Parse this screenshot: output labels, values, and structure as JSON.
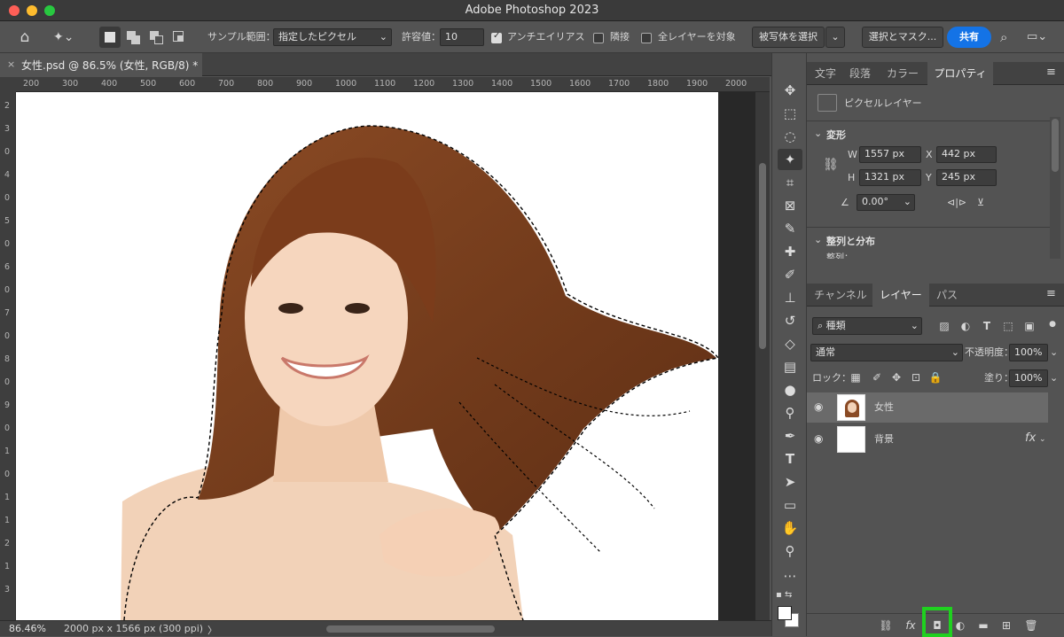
{
  "app": {
    "title": "Adobe Photoshop 2023"
  },
  "options_bar": {
    "sample_label": "サンプル範囲：",
    "sample_value": "指定したピクセル",
    "tolerance_label": "許容値：",
    "tolerance_value": "10",
    "antialias_label": "アンチエイリアス",
    "antialias_checked": true,
    "contiguous_label": "隣接",
    "contiguous_checked": false,
    "all_layers_label": "全レイヤーを対象",
    "all_layers_checked": false,
    "select_subject": "被写体を選択",
    "select_mask": "選択とマスク...",
    "share": "共有"
  },
  "document": {
    "tab_title": "女性.psd @ 86.5% (女性, RGB/8) *",
    "close_glyph": "×"
  },
  "ruler": {
    "h_ticks": [
      "200",
      "300",
      "400",
      "500",
      "600",
      "700",
      "800",
      "900",
      "1000",
      "1100",
      "1200",
      "1300",
      "1400",
      "1500",
      "1600",
      "1700",
      "1800",
      "1900",
      "2000"
    ],
    "v_ticks": [
      "2",
      "3",
      "0",
      "4",
      "0",
      "5",
      "0",
      "6",
      "0",
      "7",
      "0",
      "8",
      "0",
      "9",
      "0",
      "1",
      "0",
      "1",
      "1",
      "2",
      "1",
      "3"
    ]
  },
  "status": {
    "zoom": "86.46%",
    "doc_info": "2000 px x 1566 px (300 ppi)",
    "arrow": "〉"
  },
  "properties_panel": {
    "tabs": [
      "文字",
      "段落",
      "カラー",
      "プロパティ"
    ],
    "active_tab": "プロパティ",
    "kind": "ピクセルレイヤー",
    "transform_title": "変形",
    "w_label": "W",
    "w_value": "1557 px",
    "x_label": "X",
    "x_value": "442 px",
    "h_label": "H",
    "h_value": "1321 px",
    "y_label": "Y",
    "y_value": "245 px",
    "angle_value": "0.00°",
    "align_title": "整列と分布",
    "align_sub": "整列："
  },
  "layers_panel": {
    "tabs": [
      "チャンネル",
      "レイヤー",
      "パス"
    ],
    "active_tab": "レイヤー",
    "filter_value": "種類",
    "blend_mode": "通常",
    "opacity_label": "不透明度：",
    "opacity_value": "100%",
    "lock_label": "ロック：",
    "fill_label": "塗り：",
    "fill_value": "100%",
    "layers": [
      {
        "name": "女性",
        "selected": true
      },
      {
        "name": "背景",
        "selected": false,
        "fx": "fx"
      }
    ],
    "highlight_color": "#1fd11f"
  },
  "colors": {
    "accent": "#1473e6",
    "canvas_bg": "#282828",
    "ui": "#535353"
  }
}
